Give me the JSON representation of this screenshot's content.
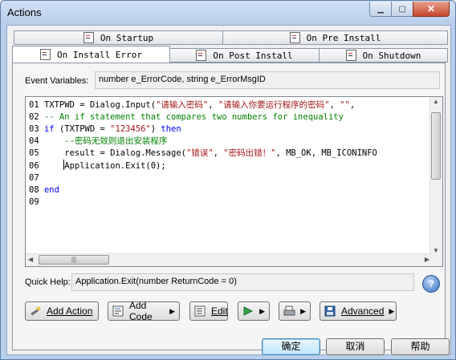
{
  "window": {
    "title": "Actions"
  },
  "tabs": {
    "row1": [
      {
        "label": "On Startup"
      },
      {
        "label": "On Pre Install"
      }
    ],
    "row2": [
      {
        "label": "On Install Error",
        "active": true
      },
      {
        "label": "On Post Install"
      },
      {
        "label": "On Shutdown"
      }
    ]
  },
  "event_variables": {
    "label": "Event Variables:",
    "value": "number e_ErrorCode, string e_ErrorMsgID"
  },
  "code": {
    "lines": [
      {
        "num": "01",
        "parts": [
          {
            "t": "TXTPWD = Dialog.Input(",
            "c": "ln"
          },
          {
            "t": "\"请输入密码\"",
            "c": "str"
          },
          {
            "t": ", ",
            "c": "ln"
          },
          {
            "t": "\"请输入你要运行程序的密码\"",
            "c": "str"
          },
          {
            "t": ", ",
            "c": "ln"
          },
          {
            "t": "\"\"",
            "c": "str"
          },
          {
            "t": ",",
            "c": "ln"
          }
        ]
      },
      {
        "num": "02",
        "parts": [
          {
            "t": "-- An if statement that compares two numbers for inequality",
            "c": "cmt"
          }
        ]
      },
      {
        "num": "03",
        "parts": [
          {
            "t": "if",
            "c": "kw"
          },
          {
            "t": " (TXTPWD = ",
            "c": "ln"
          },
          {
            "t": "\"123456\"",
            "c": "str"
          },
          {
            "t": ") ",
            "c": "ln"
          },
          {
            "t": "then",
            "c": "kw"
          }
        ]
      },
      {
        "num": "04",
        "parts": [
          {
            "t": "    --密码无效则退出安装程序",
            "c": "cmt"
          }
        ]
      },
      {
        "num": "05",
        "parts": [
          {
            "t": "    result = Dialog.Message(",
            "c": "ln"
          },
          {
            "t": "\"错误\"",
            "c": "str"
          },
          {
            "t": ", ",
            "c": "ln"
          },
          {
            "t": "\"密码出错！\"",
            "c": "str"
          },
          {
            "t": ", MB_OK, MB_ICONINFO",
            "c": "ln"
          }
        ]
      },
      {
        "num": "06",
        "parts": [
          {
            "t": "    ",
            "c": "ln"
          },
          {
            "t": "CARET",
            "c": "caret"
          },
          {
            "t": "Application.Exit(0);",
            "c": "ln"
          }
        ]
      },
      {
        "num": "07",
        "parts": []
      },
      {
        "num": "08",
        "parts": [
          {
            "t": "end",
            "c": "kw"
          }
        ]
      },
      {
        "num": "09",
        "parts": []
      }
    ]
  },
  "quick_help": {
    "label": "Quick Help:",
    "value": "Application.Exit(number ReturnCode = 0)"
  },
  "toolbar": {
    "add_action": "Add Action",
    "add_code": "Add Code",
    "edit": "Edit",
    "advanced": "Advanced"
  },
  "dialog_buttons": {
    "ok": "确定",
    "cancel": "取消",
    "help": "帮助"
  },
  "colors": {
    "keyword": "#0000ff",
    "string": "#a31515",
    "comment": "#008000",
    "title_bar": "#b7cfea"
  }
}
